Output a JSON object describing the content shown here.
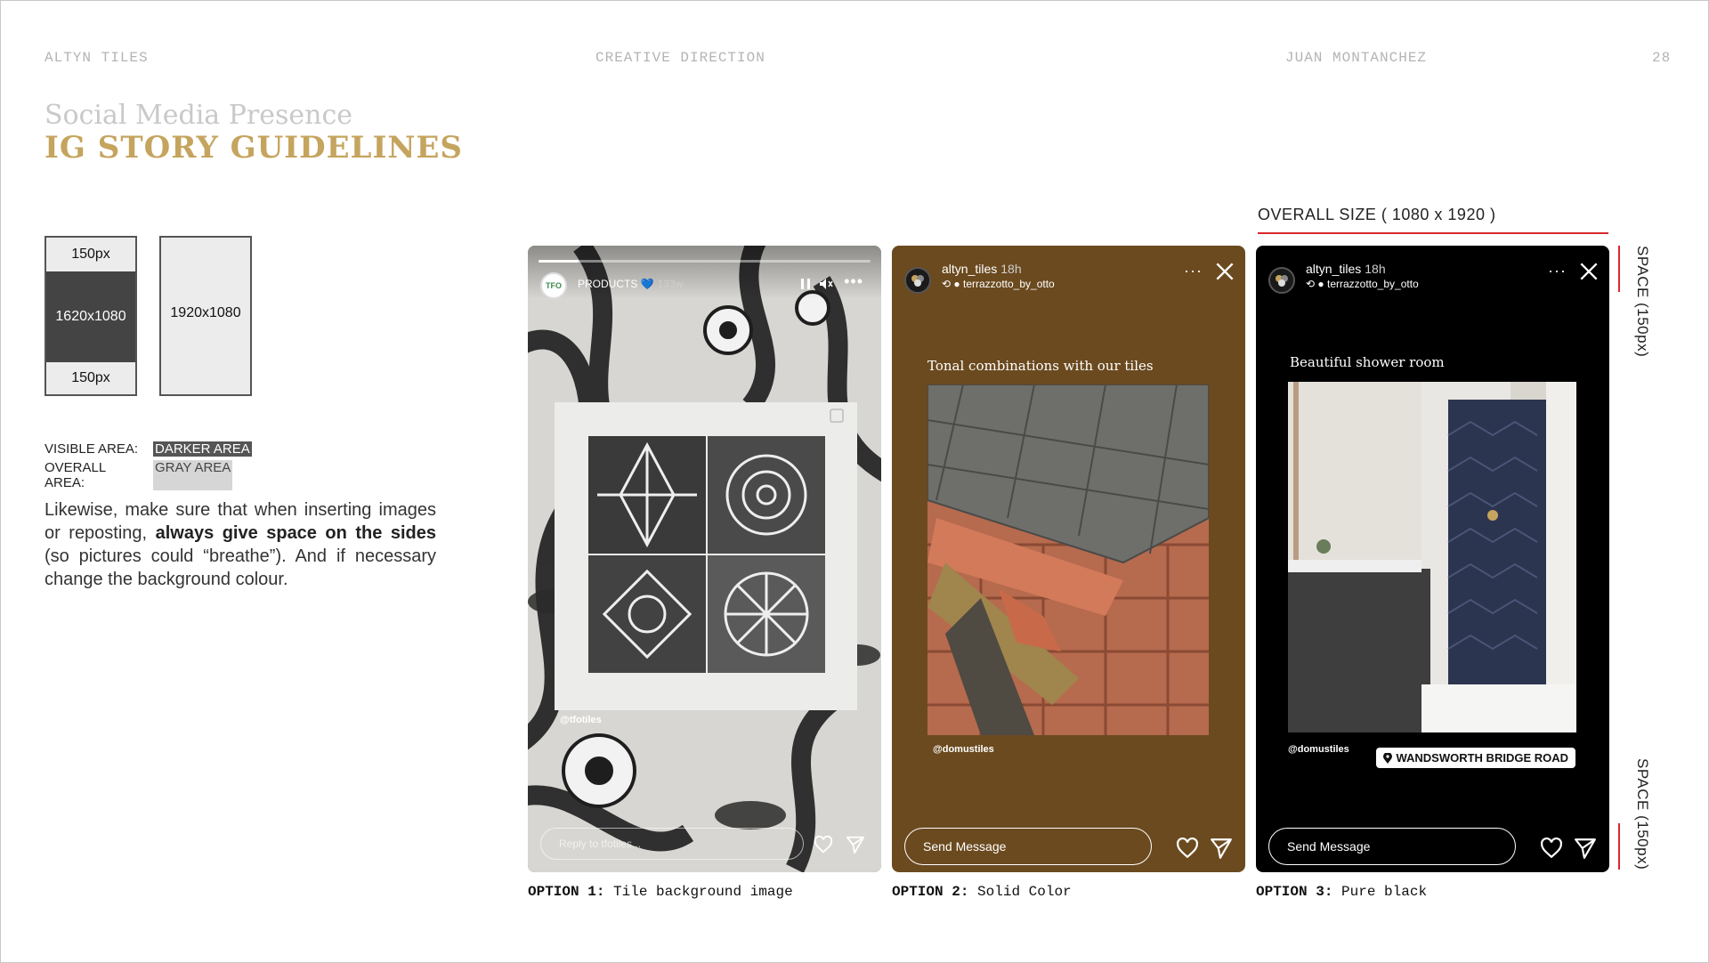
{
  "header": {
    "brand": "ALTYN TILES",
    "section": "CREATIVE DIRECTION",
    "author": "JUAN MONTANCHEZ",
    "page_number": "28"
  },
  "heading": {
    "subtitle": "Social Media Presence",
    "title": "IG STORY GUIDELINES"
  },
  "diagram": {
    "top_space": "150px",
    "visible": "1620x1080",
    "bottom_space": "150px",
    "overall": "1920x1080"
  },
  "legend": {
    "visible_key": "VISIBLE AREA:",
    "visible_value": "DARKER AREA",
    "overall_key": "OVERALL AREA:",
    "overall_value": "GRAY AREA"
  },
  "body": {
    "part1": "Likewise, make sure that when inserting images or reposting, ",
    "bold": "always give space on the sides",
    "part2": " (so pictures could “breathe”). And if necessary change the background colour."
  },
  "overall_size": "OVERALL SIZE ( 1080 x 1920 )",
  "space_top": "SPACE (150px)",
  "space_bottom": "SPACE (150px)",
  "stories": [
    {
      "user": "PRODUCTS 💙",
      "time": "133w",
      "avatar_text": "TFO",
      "handle": "@tfotiles",
      "message_placeholder": "Reply to tfotiles...",
      "option_prefix": "OPTION 1:",
      "option_text": "Tile background image"
    },
    {
      "user": "altyn_tiles",
      "time": "18h",
      "sub": "terrazzotto_by_otto",
      "caption": "Tonal combinations with our tiles",
      "handle": "@domustiles",
      "message_placeholder": "Send Message",
      "option_prefix": "OPTION 2:",
      "option_text": "Solid Color",
      "background": "#6b4a1f"
    },
    {
      "user": "altyn_tiles",
      "time": "18h",
      "sub": "terrazzotto_by_otto",
      "caption": "Beautiful shower room",
      "handle": "@domustiles",
      "location": "WANDSWORTH BRIDGE ROAD",
      "message_placeholder": "Send Message",
      "option_prefix": "OPTION 3:",
      "option_text": "Pure black",
      "background": "#000000"
    }
  ],
  "colors": {
    "title_gold": "#c5a45e",
    "accent_red": "#d9282f"
  }
}
